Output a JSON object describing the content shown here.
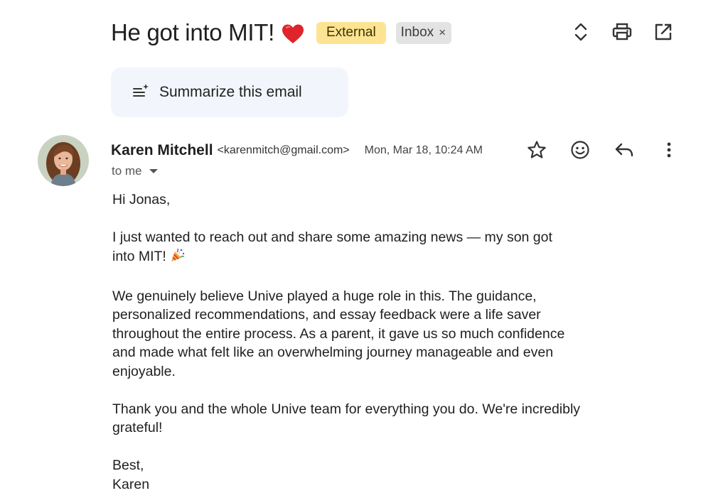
{
  "subject": {
    "title": "He got into MIT!",
    "emoji_icon": "red-heart-icon",
    "labels": [
      {
        "text": "External",
        "color": "#fde493"
      },
      {
        "text": "Inbox",
        "remove": "×",
        "color": "#e3e3e3"
      }
    ]
  },
  "toolbar": {
    "icons": [
      "expand-collapse-icon",
      "print-icon",
      "open-in-new-window-icon"
    ]
  },
  "summarize": {
    "label": "Summarize this email",
    "icon": "sparkle-list-icon",
    "bg_color": "#f2f6fc"
  },
  "message": {
    "sender_name": "Karen Mitchell",
    "sender_email": "<karenmitch@gmail.com>",
    "date": "Mon, Mar 18, 10:24 AM",
    "to": "to me",
    "action_icons": [
      "star-icon",
      "emoji-reaction-icon",
      "reply-icon",
      "more-vert-icon"
    ],
    "avatar_icon": "sender-avatar",
    "body": {
      "greeting": "Hi Jonas,",
      "p1_l1": "I just wanted to reach out and share some amazing news — my son got",
      "p1_l2": "into MIT!",
      "p1_emoji": "party-popper-icon",
      "p2_l1": "We genuinely believe Unive played a huge role in this. The guidance,",
      "p2_l2": "personalized recommendations, and essay feedback were a life saver",
      "p2_l3": "throughout the entire process. As a parent, it gave us so much confidence",
      "p2_l4": "and made what felt like an overwhelming journey manageable and even",
      "p2_l5": "enjoyable.",
      "p3_l1": "Thank you and the whole Unive team for everything you do. We're incredibly",
      "p3_l2": "grateful!",
      "signoff": "Best,",
      "signature": "Karen"
    }
  }
}
